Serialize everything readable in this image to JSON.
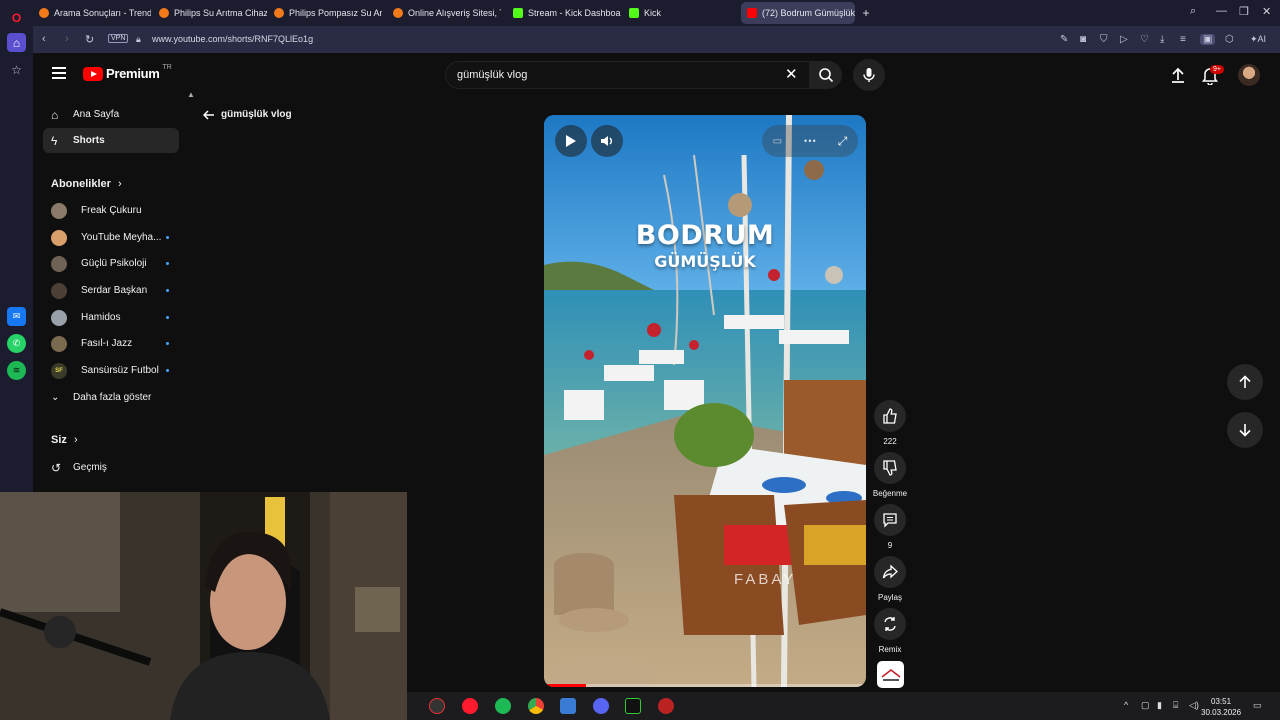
{
  "browser": {
    "tabs": [
      {
        "label": "Arama Sonuçları - Trendyol",
        "color": "#f27a1a"
      },
      {
        "label": "Philips Su Arıtma Cihazı Mo",
        "color": "#f27a1a"
      },
      {
        "label": "Philips Pompasız Su Arıtma",
        "color": "#f27a1a"
      },
      {
        "label": "Online Alışveriş Sitesi, Türk",
        "color": "#f27a1a"
      },
      {
        "label": "Stream - Kick Dashboard",
        "color": "#53fc18"
      },
      {
        "label": "Kick",
        "color": "#53fc18"
      },
      {
        "label": "(72) Bodrum Gümüşlük -",
        "color": "#ff0000"
      }
    ],
    "new_tab_label": "+",
    "vpn_label": "VPN",
    "url": "www.youtube.com/shorts/RNF7QLlEo1g",
    "ai_label": "AI"
  },
  "youtube": {
    "logo_text": "Premium",
    "logo_region": "TR",
    "search_value": "gümüşlük vlog",
    "notification_count": "9+",
    "guide": {
      "home": "Ana Sayfa",
      "shorts": "Shorts",
      "subscriptions_heading": "Abonelikler",
      "channels": [
        {
          "name": "Freak Çukuru",
          "color": "#8a7a6a",
          "new": false
        },
        {
          "name": "YouTube Meyha...",
          "color": "#d9a06b",
          "new": true
        },
        {
          "name": "Güçlü Psikoloji",
          "color": "#6e6355",
          "new": true
        },
        {
          "name": "Serdar Başkan",
          "color": "#4c4036",
          "new": true
        },
        {
          "name": "Hamidos",
          "color": "#9aa0a8",
          "new": true
        },
        {
          "name": "Fasıl-ı Jazz",
          "color": "#7a6a50",
          "new": true
        },
        {
          "name": "Sansürsüz Futbol",
          "color": "#3b3b2a",
          "new": true,
          "initials": "SF"
        }
      ],
      "show_more": "Daha fazla göster",
      "you_heading": "Siz",
      "history": "Geçmiş"
    },
    "query_back": "gümüşlük vlog",
    "short": {
      "title_main": "BODRUM",
      "title_sub": "GÜMÜŞLÜK",
      "watermark": "FABAY",
      "progress": 0.13
    },
    "actions": {
      "likes": "222",
      "dislike": "Beğenme",
      "comments": "9",
      "share": "Paylaş",
      "remix": "Remix"
    }
  },
  "taskbar": {
    "time": "03:51",
    "date": "30.03.2026"
  }
}
